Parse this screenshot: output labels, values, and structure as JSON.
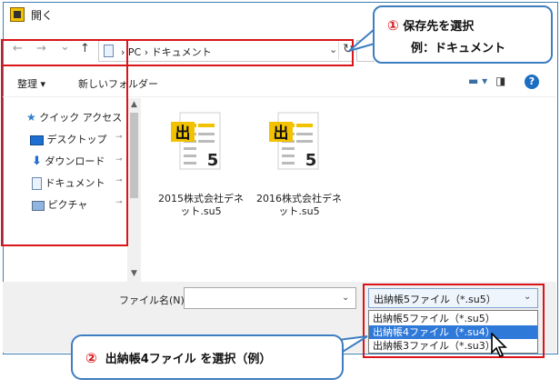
{
  "window": {
    "title": "開く"
  },
  "nav": {
    "back": "←",
    "forward": "→",
    "recent": "⌄",
    "up": "↑"
  },
  "address": {
    "path": "›  PC  ›  ドキュメント",
    "chevron": "⌄",
    "refresh": "↻"
  },
  "toolbar": {
    "organize": "整理 ▾",
    "new_folder": "新しいフォルダー",
    "view_icon": "▬ ▾",
    "pane_icon": "◨",
    "help": "?"
  },
  "sidebar": {
    "items": [
      {
        "label": "クイック アクセス",
        "icon": "star-icon",
        "pinned": false
      },
      {
        "label": "デスクトップ",
        "icon": "desktop-icon",
        "pinned": true
      },
      {
        "label": "ダウンロード",
        "icon": "download-arrow-icon",
        "pinned": true
      },
      {
        "label": "ドキュメント",
        "icon": "document-icon",
        "pinned": true
      },
      {
        "label": "ピクチャ",
        "icon": "pictures-icon",
        "pinned": true
      }
    ],
    "pin_glyph": "📌"
  },
  "files": [
    {
      "name_line1": "2015株式会社デネ",
      "name_line2": "ット.su5",
      "icon_char": "出",
      "icon_num": "5"
    },
    {
      "name_line1": "2016株式会社デネ",
      "name_line2": "ット.su5",
      "icon_char": "出",
      "icon_num": "5"
    }
  ],
  "footer": {
    "filename_label": "ファイル名(N):",
    "filename_value": "",
    "filetype_selected": "出納帳5ファイル（*.su5）",
    "filetype_options": [
      {
        "label": "出納帳5ファイル（*.su5）",
        "selected": false
      },
      {
        "label": "出納帳4ファイル（*.su4）",
        "selected": true
      },
      {
        "label": "出納帳3ファイル（*.su3）",
        "selected": false
      }
    ]
  },
  "annotations": {
    "step1_num": "①",
    "step1_line1": "保存先を選択",
    "step1_line2": "例：ドキュメント",
    "step2_num": "②",
    "step2_text": "出納帳4ファイル を選択（例）"
  },
  "colors": {
    "accent_red": "#d9141a",
    "callout_border": "#3d7dc0",
    "selected_blue": "#2f79d9",
    "icon_yellow": "#f2c200"
  }
}
